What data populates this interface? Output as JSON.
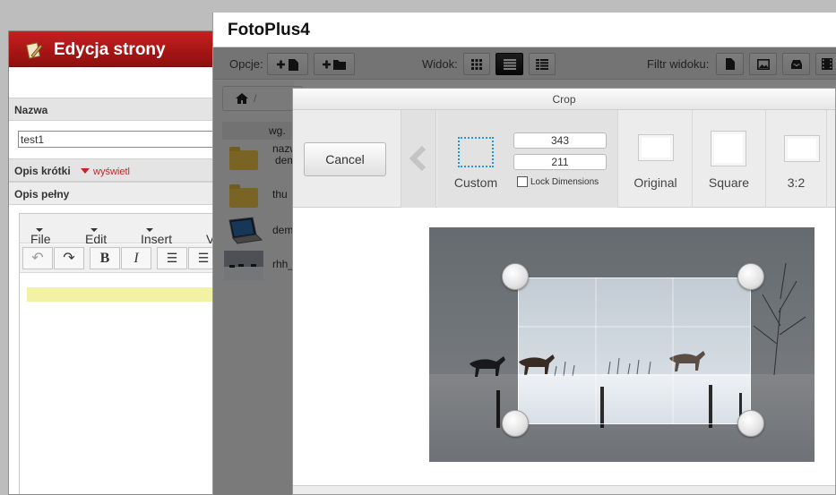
{
  "cms": {
    "title": "Edycja strony",
    "name_label": "Nazwa",
    "name_value": "test1",
    "short_desc_label": "Opis krótki",
    "show_link": "wyświetl",
    "full_desc_label": "Opis pełny",
    "editor_menu": [
      "File",
      "Edit",
      "Insert",
      "V"
    ]
  },
  "fotoplus": {
    "title": "FotoPlus4",
    "options_label": "Opcje:",
    "view_label": "Widok:",
    "filter_label": "Filtr widoku:",
    "sort_label": "wg.",
    "files": [
      {
        "name": "nazw",
        "name2": "dem",
        "kind": "folder"
      },
      {
        "name": "thu",
        "kind": "folder"
      },
      {
        "name": "dem",
        "kind": "laptop"
      },
      {
        "name": "rhh_",
        "kind": "horses"
      }
    ]
  },
  "crop": {
    "title": "Crop",
    "cancel_label": "Cancel",
    "custom_label": "Custom",
    "width_value": "343",
    "height_value": "211",
    "lock_label": "Lock Dimensions",
    "presets": [
      "Original",
      "Square",
      "3:2"
    ]
  },
  "icons": [
    "page-edit-icon",
    "add-file-icon",
    "add-folder-icon",
    "grid-view-icon",
    "list-view-icon",
    "detail-view-icon",
    "file-filter-icon",
    "image-filter-icon",
    "inbox-filter-icon",
    "film-filter-icon",
    "home-icon",
    "chevron-left-icon",
    "undo-icon",
    "redo-icon",
    "bold-icon",
    "italic-icon",
    "align-left-icon",
    "align-center-icon"
  ]
}
